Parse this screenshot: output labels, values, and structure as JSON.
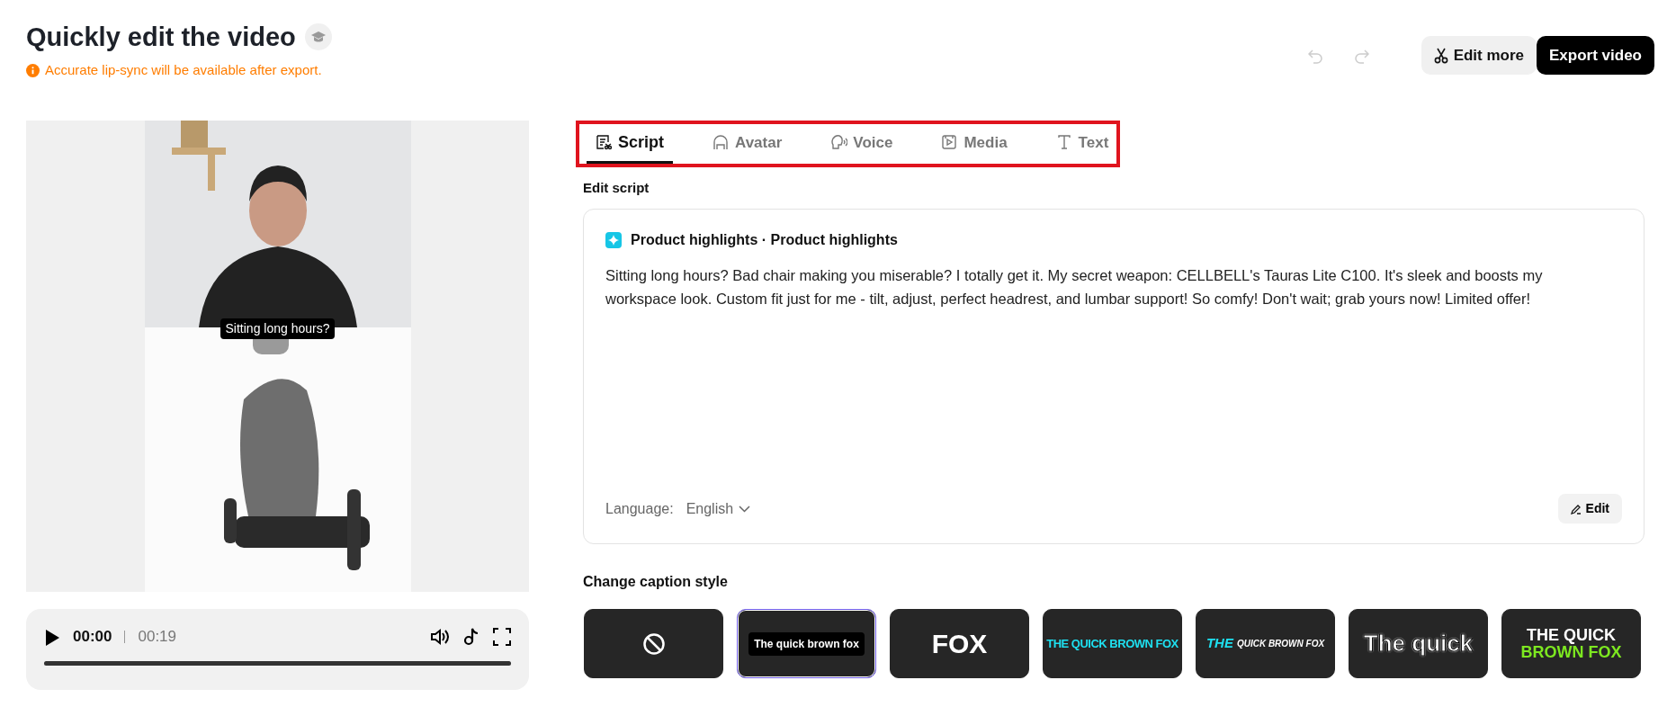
{
  "header": {
    "title": "Quickly edit the video",
    "notice": "Accurate lip-sync will be available after export."
  },
  "history": [
    {
      "kind": "undo",
      "disabled": true
    },
    {
      "kind": "redo",
      "disabled": true
    }
  ],
  "actions": [
    {
      "label": "Edit more",
      "kind": "secondary"
    },
    {
      "label": "Export video",
      "kind": "primary"
    }
  ],
  "preview": {
    "caption": "Sitting long hours?",
    "current_time": "00:00",
    "duration": "00:19"
  },
  "tabs": [
    {
      "label": "Script",
      "kind": "script",
      "selected": true
    },
    {
      "label": "Avatar",
      "kind": "avatar",
      "selected": false
    },
    {
      "label": "Voice",
      "kind": "voice",
      "selected": false
    },
    {
      "label": "Media",
      "kind": "media",
      "selected": false
    },
    {
      "label": "Text",
      "kind": "text",
      "selected": false
    }
  ],
  "script": {
    "section_label": "Edit script",
    "title": "Product highlights · Product highlights",
    "body": "Sitting long hours? Bad chair making you miserable? I totally get it. My secret weapon: CELLBELL's Tauras Lite C100. It's sleek and boosts my workspace look. Custom fit just for me - tilt, adjust, perfect headrest, and lumbar support! So comfy! Don't wait; grab yours now! Limited offer!",
    "language_label": "Language:",
    "language": "English",
    "edit_button": "Edit"
  },
  "caption_styles": {
    "title": "Change caption style",
    "items": [
      {
        "kind": "none",
        "selected": false
      },
      {
        "kind": "plain",
        "texts": [
          "The quick brown fox"
        ],
        "selected": true
      },
      {
        "kind": "fox",
        "texts": [
          "FOX"
        ],
        "selected": false
      },
      {
        "kind": "cyan",
        "texts": [
          "THE QUICK BROWN FOX"
        ],
        "selected": false
      },
      {
        "kind": "italic",
        "texts": [
          "THE",
          "QUICK BROWN FOX"
        ],
        "selected": false
      },
      {
        "kind": "outline",
        "texts": [
          "The quick"
        ],
        "selected": false
      },
      {
        "kind": "green",
        "texts": [
          "THE QUICK",
          "BROWN FOX"
        ],
        "selected": false
      }
    ]
  }
}
